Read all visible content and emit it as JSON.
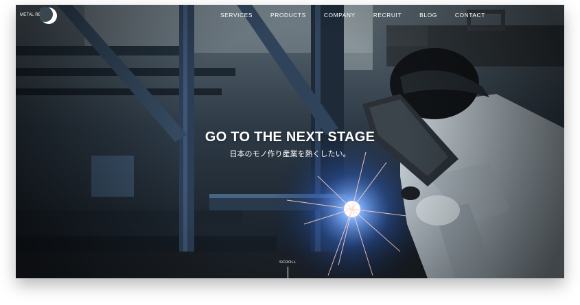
{
  "brand": {
    "logo_text": "METAL REVISION"
  },
  "nav": {
    "items": [
      {
        "label": "SERVICES"
      },
      {
        "label": "PRODUCTS"
      },
      {
        "label": "COMPANY"
      },
      {
        "label": "RECRUIT"
      },
      {
        "label": "BLOG"
      },
      {
        "label": "CONTACT"
      }
    ]
  },
  "hero": {
    "title": "GO TO THE NEXT STAGE",
    "subtitle": "日本のモノ作り産業を熱くしたい。",
    "scroll_label": "SCROLL"
  },
  "colors": {
    "text": "#ffffff",
    "spark": "#8fb8ff",
    "backdrop": "#1b2430"
  }
}
